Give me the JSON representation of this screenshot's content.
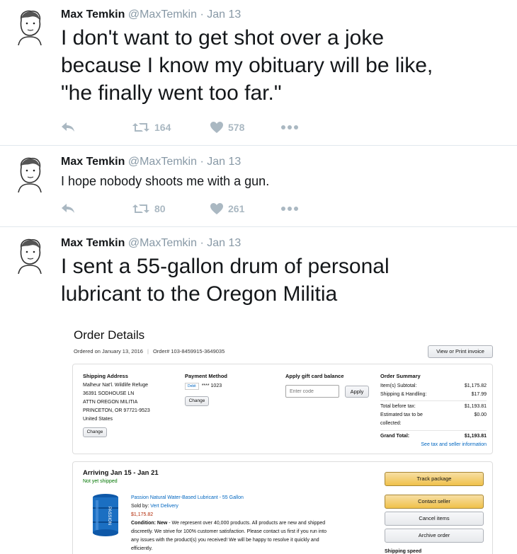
{
  "tweets": [
    {
      "name": "Max Temkin",
      "handle": "@MaxTemkin",
      "dot": "·",
      "date": "Jan 13",
      "lines": [
        "I don't want to get shot over a joke",
        "because I know my obituary will be like,",
        "\"he finally went too far.\""
      ],
      "retweets": "164",
      "likes": "578"
    },
    {
      "name": "Max Temkin",
      "handle": "@MaxTemkin",
      "dot": "·",
      "date": "Jan 13",
      "lines": [
        "I hope nobody shoots me with a gun."
      ],
      "retweets": "80",
      "likes": "261"
    },
    {
      "name": "Max Temkin",
      "handle": "@MaxTemkin",
      "dot": "·",
      "date": "Jan 13",
      "lines": [
        "I sent a 55-gallon drum of personal",
        "lubricant to the Oregon Militia"
      ]
    }
  ],
  "order": {
    "title": "Order Details",
    "ordered_on": "Ordered on January 13, 2016",
    "order_number": "Order# 103-8459915-3649035",
    "invoice_button": "View or Print invoice",
    "shipping": {
      "label": "Shipping Address",
      "lines": [
        "Malheur Nat'l. Wildlife Refuge",
        "36391 SODHOUSE LN",
        "ATTN OREGON MILITIA",
        "PRINCETON, OR 97721-9523",
        "United States"
      ],
      "change": "Change"
    },
    "payment": {
      "label": "Payment Method",
      "card_badge": "Debit",
      "card": "**** 1023",
      "change": "Change"
    },
    "gift": {
      "label": "Apply gift card balance",
      "placeholder": "Enter code",
      "apply": "Apply"
    },
    "summary": {
      "label": "Order Summary",
      "rows": [
        {
          "k": "Item(s) Subtotal:",
          "v": "$1,175.82"
        },
        {
          "k": "Shipping & Handling:",
          "v": "$17.99"
        },
        {
          "k": "Total before tax:",
          "v": "$1,193.81"
        },
        {
          "k": "Estimated tax to be",
          "v": "$0.00"
        },
        {
          "k": "collected:",
          "v": ""
        }
      ],
      "grand_label": "Grand Total:",
      "grand_value": "$1,193.81",
      "tax_link": "See tax and seller information"
    },
    "shipment": {
      "arriving": "Arriving Jan 15 - Jan 21",
      "status": "Not yet shipped",
      "product": "Passion Natural Water-Based Lubricant - 55 Gallon",
      "sold_by_prefix": "Sold by:",
      "seller": "Vert Delivery",
      "price": "$1,175.82",
      "condition_label": "Condition: New",
      "condition_lines": [
        " - We represent over 40,000 products. All products are new and shipped",
        "discreetly. We strive for 100% customer satisfaction. Please contact us first if you run into",
        "any issues with the product(s) you received! We will be happy to resolve it quickly and",
        "efficiently."
      ],
      "drum_text": "PASSION",
      "buttons": [
        "Track package",
        "Contact seller",
        "Cancel items",
        "Archive order"
      ],
      "shipping_speed": "Shipping speed"
    }
  },
  "colors": {
    "accent_link": "#0066c0",
    "drum": "#1b6fc2",
    "icon_gray": "#aab8c2"
  }
}
